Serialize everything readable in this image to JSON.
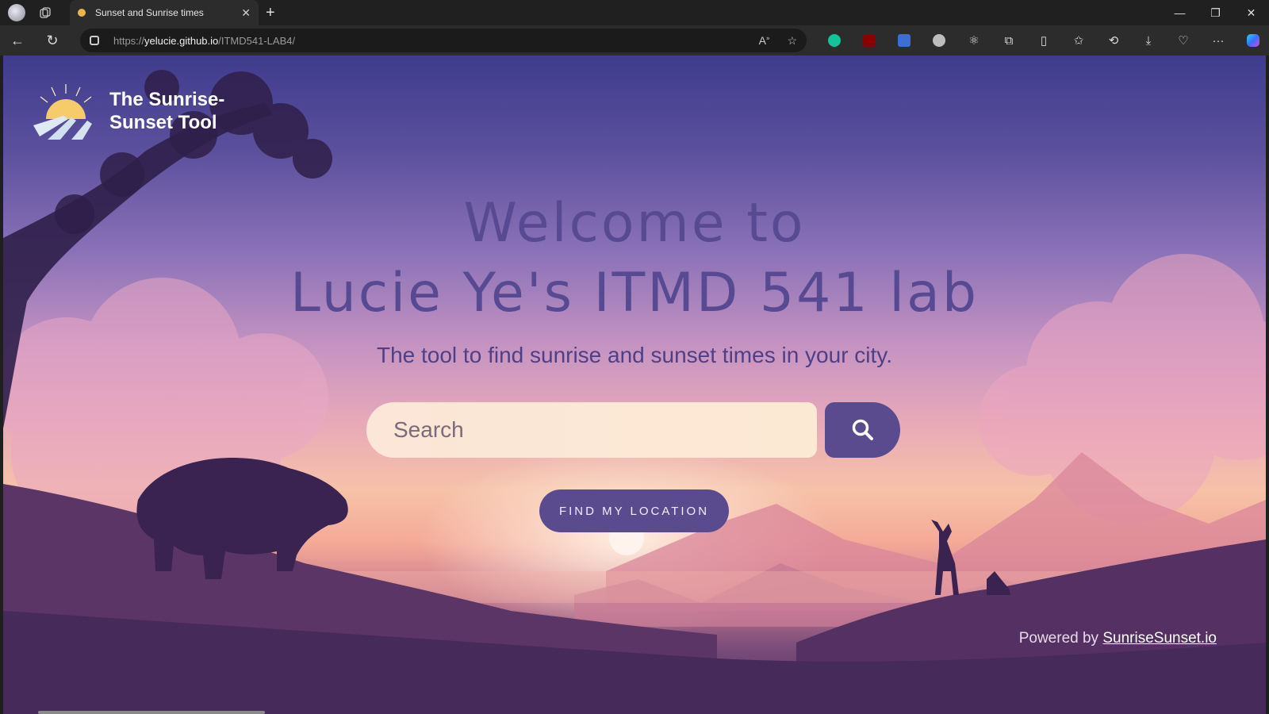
{
  "browser": {
    "tab_title": "Sunset and Sunrise times",
    "url_scheme": "https://",
    "url_host": "yelucie.github.io",
    "url_path": "/ITMD541-LAB4/",
    "icons": [
      "profile-icon",
      "workspaces-icon",
      "close-icon",
      "new-tab-icon",
      "back-icon",
      "refresh-icon",
      "lock-icon",
      "read-aloud-icon",
      "favorite-icon",
      "grammarly-icon",
      "ublock-icon",
      "translate-icon",
      "extension-icon",
      "react-icon",
      "extensions-icon",
      "split-screen-icon",
      "favorites-icon",
      "history-icon",
      "downloads-icon",
      "performance-icon",
      "more-icon",
      "copilot-icon"
    ]
  },
  "site": {
    "logo_line1": "The Sunrise-",
    "logo_line2": "Sunset Tool",
    "title_line1": "Welcome to",
    "title_line2": "Lucie Ye's ITMD 541 lab",
    "subtitle": "The tool to find sunrise and sunset times in your city.",
    "search_placeholder": "Search",
    "find_location_label": "FIND MY LOCATION",
    "powered_prefix": "Powered by ",
    "powered_link": "SunriseSunset.io"
  },
  "colors": {
    "accent": "#5a4a8e",
    "title": "#574a92"
  }
}
